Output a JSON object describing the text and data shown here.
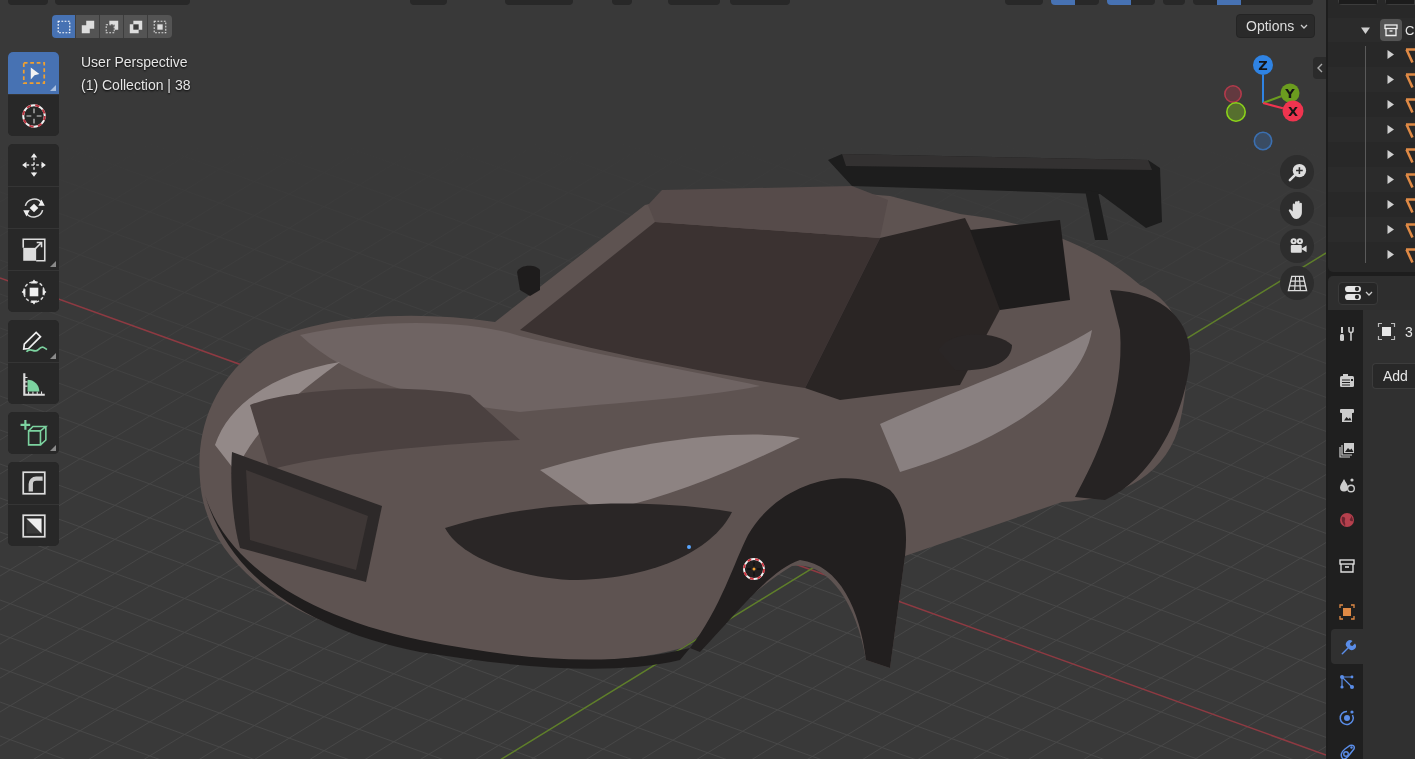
{
  "header": {
    "controls": [
      {
        "segments": [
          {
            "selected": false
          }
        ]
      },
      {
        "segments": [
          {
            "selected": false
          }
        ]
      },
      {
        "segments": [
          {
            "selected": false
          }
        ]
      },
      {
        "segments": [
          {
            "selected": false
          }
        ]
      },
      {
        "segments": [
          {
            "selected": false
          }
        ]
      },
      {
        "segments": [
          {
            "selected": false
          }
        ]
      },
      {
        "segments": [
          {
            "selected": false
          }
        ]
      },
      {
        "segments": [
          {
            "selected": false
          }
        ]
      },
      {
        "segments": [
          {
            "selected": true
          },
          {
            "selected": false
          }
        ]
      },
      {
        "segments": [
          {
            "selected": true
          },
          {
            "selected": false
          }
        ]
      },
      {
        "segments": [
          {
            "selected": false
          }
        ]
      },
      {
        "segments": [
          {
            "selected": false
          },
          {
            "selected": true
          },
          {
            "selected": false
          },
          {
            "selected": false
          },
          {
            "selected": false
          }
        ]
      }
    ]
  },
  "select_modes": [
    {
      "kind": "set",
      "selected": true
    },
    {
      "kind": "extend",
      "selected": false
    },
    {
      "kind": "subtract",
      "selected": false
    },
    {
      "kind": "difference",
      "selected": false
    },
    {
      "kind": "intersect",
      "selected": false
    }
  ],
  "toolbar": {
    "groups": [
      {
        "tools": [
          {
            "kind": "select_box",
            "selected": true,
            "submenu": true
          },
          {
            "kind": "cursor",
            "selected": false,
            "submenu": false
          }
        ]
      },
      {
        "tools": [
          {
            "kind": "move",
            "selected": false,
            "submenu": false
          },
          {
            "kind": "rotate",
            "selected": false,
            "submenu": false
          },
          {
            "kind": "scale",
            "selected": false,
            "submenu": true
          },
          {
            "kind": "transform",
            "selected": false,
            "submenu": false
          }
        ]
      },
      {
        "tools": [
          {
            "kind": "annotate",
            "selected": false,
            "submenu": true
          },
          {
            "kind": "measure",
            "selected": false,
            "submenu": false
          }
        ]
      },
      {
        "tools": [
          {
            "kind": "add_cube",
            "selected": false,
            "submenu": true
          }
        ]
      },
      {
        "tools": [
          {
            "kind": "fillet",
            "selected": false,
            "submenu": false
          },
          {
            "kind": "diagonal",
            "selected": false,
            "submenu": false
          }
        ]
      }
    ]
  },
  "viewport": {
    "view_name": "User Perspective",
    "info": "(1) Collection | 38",
    "options_label": "Options"
  },
  "gizmo": {
    "axes": [
      {
        "kind": "z",
        "label": "Z",
        "color": "#2f83e3"
      },
      {
        "kind": "y",
        "label": "Y",
        "color": "#6b9c1f"
      },
      {
        "kind": "x",
        "label": "X",
        "color": "#f0344f"
      }
    ],
    "negative_axes": [
      {
        "kind": "x",
        "color": "#b23a4b"
      },
      {
        "kind": "y",
        "color": "#8bd31a"
      },
      {
        "kind": "z",
        "color": "#3b6fb0"
      }
    ]
  },
  "nav_buttons": [
    {
      "kind": "zoom"
    },
    {
      "kind": "pan"
    },
    {
      "kind": "camera"
    },
    {
      "kind": "ortho"
    }
  ],
  "outliner": {
    "header_controls": [
      {
        "segments": [
          {
            "selected": false
          }
        ]
      },
      {
        "segments": [
          {
            "selected": false
          }
        ]
      }
    ],
    "items": [
      {
        "label": "C",
        "expanded": true,
        "children": [
          {
            "expanded": false
          },
          {
            "expanded": false
          },
          {
            "expanded": false
          },
          {
            "expanded": false
          },
          {
            "expanded": false
          },
          {
            "expanded": false
          },
          {
            "expanded": false
          },
          {
            "expanded": false
          },
          {
            "expanded": false
          }
        ]
      }
    ]
  },
  "properties": {
    "groups": [
      {
        "tabs": [
          {
            "kind": "tool",
            "selected": false
          }
        ]
      },
      {
        "tabs": [
          {
            "kind": "render",
            "selected": false
          },
          {
            "kind": "output",
            "selected": false
          },
          {
            "kind": "view_layer",
            "selected": false
          },
          {
            "kind": "scene",
            "selected": false
          },
          {
            "kind": "world",
            "selected": false
          }
        ]
      },
      {
        "tabs": [
          {
            "kind": "collection",
            "selected": false
          }
        ]
      },
      {
        "tabs": [
          {
            "kind": "object",
            "selected": false
          },
          {
            "kind": "modifier",
            "selected": true
          },
          {
            "kind": "particles",
            "selected": false
          },
          {
            "kind": "physics",
            "selected": false
          },
          {
            "kind": "constraints",
            "selected": false
          }
        ]
      }
    ],
    "object_name": "3",
    "add_button": "Add"
  }
}
